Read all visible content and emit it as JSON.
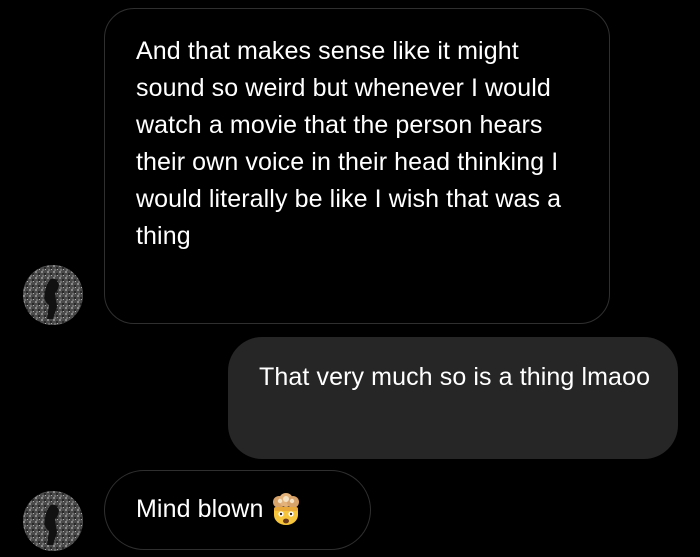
{
  "conversation": {
    "messages": [
      {
        "sender": "other",
        "text": "And that makes sense like it might sound so weird but whenever I would watch a movie that the person hears their own voice in their head thinking I would literally be like I wish that was a thing"
      },
      {
        "sender": "me",
        "text": "That very much so is a thing lmaoo"
      },
      {
        "sender": "other",
        "text": "Mind blown",
        "emoji": "exploding-head-emoji"
      }
    ]
  },
  "colors": {
    "background": "#000000",
    "incoming_bubble_border": "#2f2f2f",
    "outgoing_bubble": "#262626",
    "text": "#ffffff"
  }
}
